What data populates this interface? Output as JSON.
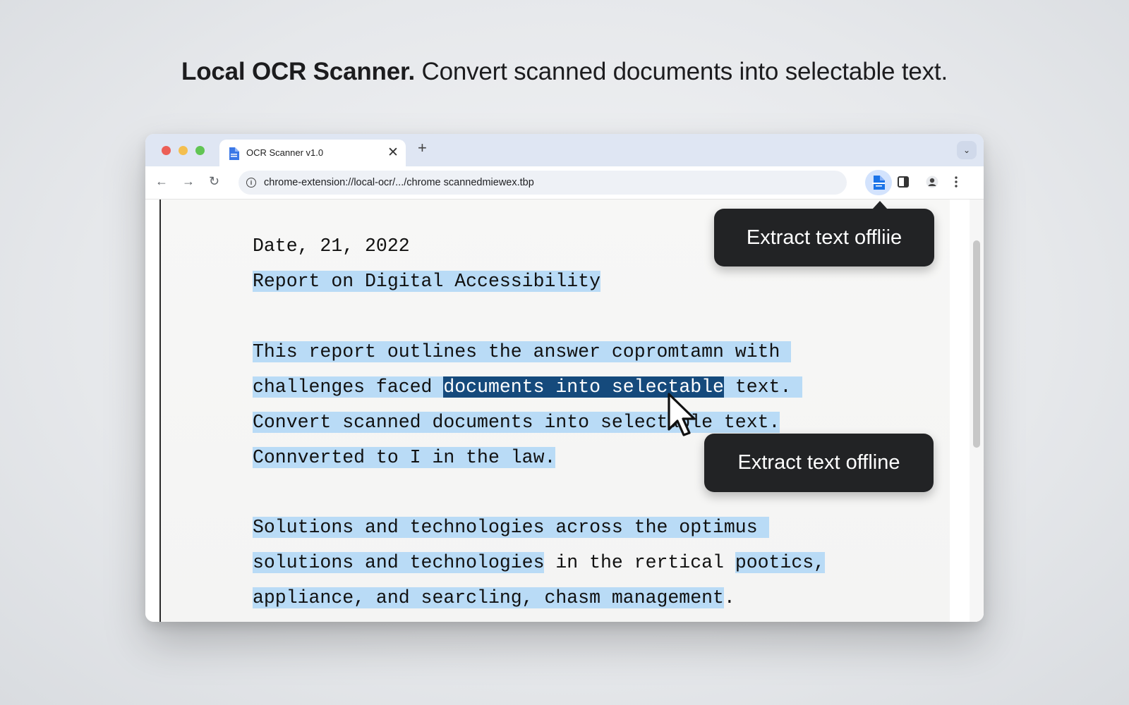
{
  "headline": {
    "bold": "Local OCR Scanner.",
    "rest": " Convert scanned documents into selectable text."
  },
  "browser": {
    "tab_title": "OCR Scanner v1.0",
    "tab_close": "✕",
    "new_tab": "+",
    "tab_dropdown": "⌄",
    "url": "chrome-extension://local-ocr/.../chrome scannedmiewex.tbp",
    "nav": {
      "back": "←",
      "forward": "→",
      "reload": "↻"
    },
    "info": "i",
    "extension_icon": "document-scan-icon",
    "toolbar_icons": [
      "side-panel-icon",
      "profile-icon",
      "kebab-menu-icon"
    ]
  },
  "document": {
    "date": "Date, 21, 2022",
    "title": "Report on Digital Accessibility",
    "p1_line1": "This report outlines the answer copromtamn with ",
    "p1_line2_a": "challenges faced ",
    "p1_line2_sel": "documents into selectable",
    "p1_line2_b": " text. ",
    "p1_line3": "Convert scanned documents into selectable text.",
    "p1_line4": "Connverted to I in the law.",
    "p2_line1": "Solutions and technologies across the optimus ",
    "p2_line2_a": "solutions and technologies",
    "p2_line2_b": " in the rertical ",
    "p2_line2_c": "pootics,",
    "p2_line3_a": "appliance, and searcling, chasm management",
    "p2_line3_b": "."
  },
  "tooltips": {
    "top": "Extract text offliie",
    "bottom": "Extract text offline"
  },
  "colors": {
    "highlight": "#b9dbf6",
    "selection": "#154a7c",
    "tooltip_bg": "#222325",
    "tabbar": "#dfe6f3"
  }
}
